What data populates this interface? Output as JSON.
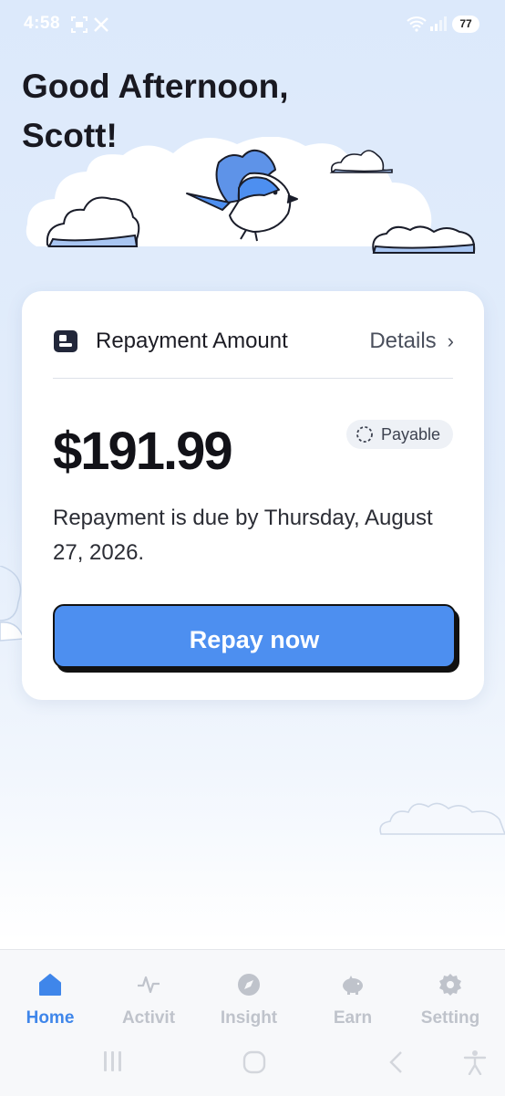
{
  "status_bar": {
    "time": "4:58",
    "battery": "77"
  },
  "greeting": {
    "line1": "Good Afternoon,",
    "line2": "Scott!"
  },
  "card": {
    "title": "Repayment Amount",
    "details_label": "Details",
    "amount": "$191.99",
    "badge": "Payable",
    "due_text": "Repayment is due by Thursday, August 27, 2026.",
    "repay_button": "Repay now"
  },
  "nav": [
    {
      "label": "Home",
      "icon": "home-icon",
      "active": true
    },
    {
      "label": "Activit",
      "icon": "activity-icon",
      "active": false
    },
    {
      "label": "Insight",
      "icon": "insight-icon",
      "active": false
    },
    {
      "label": "Earn",
      "icon": "piggy-bank-icon",
      "active": false
    },
    {
      "label": "Setting",
      "icon": "gear-icon",
      "active": false
    }
  ],
  "colors": {
    "accent": "#4d8ff0",
    "nav_active": "#3f86ea",
    "background": "#dce9fb"
  }
}
